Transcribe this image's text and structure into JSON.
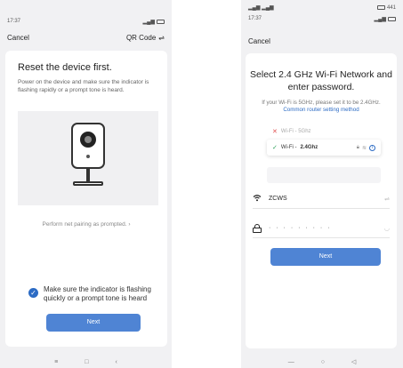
{
  "left": {
    "status_time": "17:37",
    "status_right": "  ",
    "nav": {
      "cancel_label": "Cancel",
      "mode_label": "QR Code",
      "mode_icon": "swap-icon"
    },
    "title": "Reset the device first.",
    "description": "Power on the device and make sure the indicator is flashing rapidly or a prompt tone is heard.",
    "pair_link": "Perform net pairing as prompted.",
    "confirm_text": "Make sure the indicator is flashing quickly or a prompt tone is heard",
    "next_label": "Next"
  },
  "right": {
    "status_top_right": "441",
    "status_time": "17:37",
    "nav": {
      "cancel_label": "Cancel"
    },
    "title": "Select 2.4 GHz Wi-Fi Network and enter password.",
    "description": "If your Wi-Fi is 5GHz, please set it to be 2.4GHz.",
    "description_link": "Common router setting method",
    "wifi_5g_label": "Wi-Fi - 5Ghz",
    "wifi_24_prefix": "Wi-Fi -",
    "wifi_24_band": "2.4Ghz",
    "ssid_value": "ZCWS",
    "password_mask": "· · · · · · · · ·",
    "next_label": "Next"
  },
  "colors": {
    "accent": "#4f84d4",
    "link": "#2c6bc4",
    "background": "#f1f1f3"
  }
}
